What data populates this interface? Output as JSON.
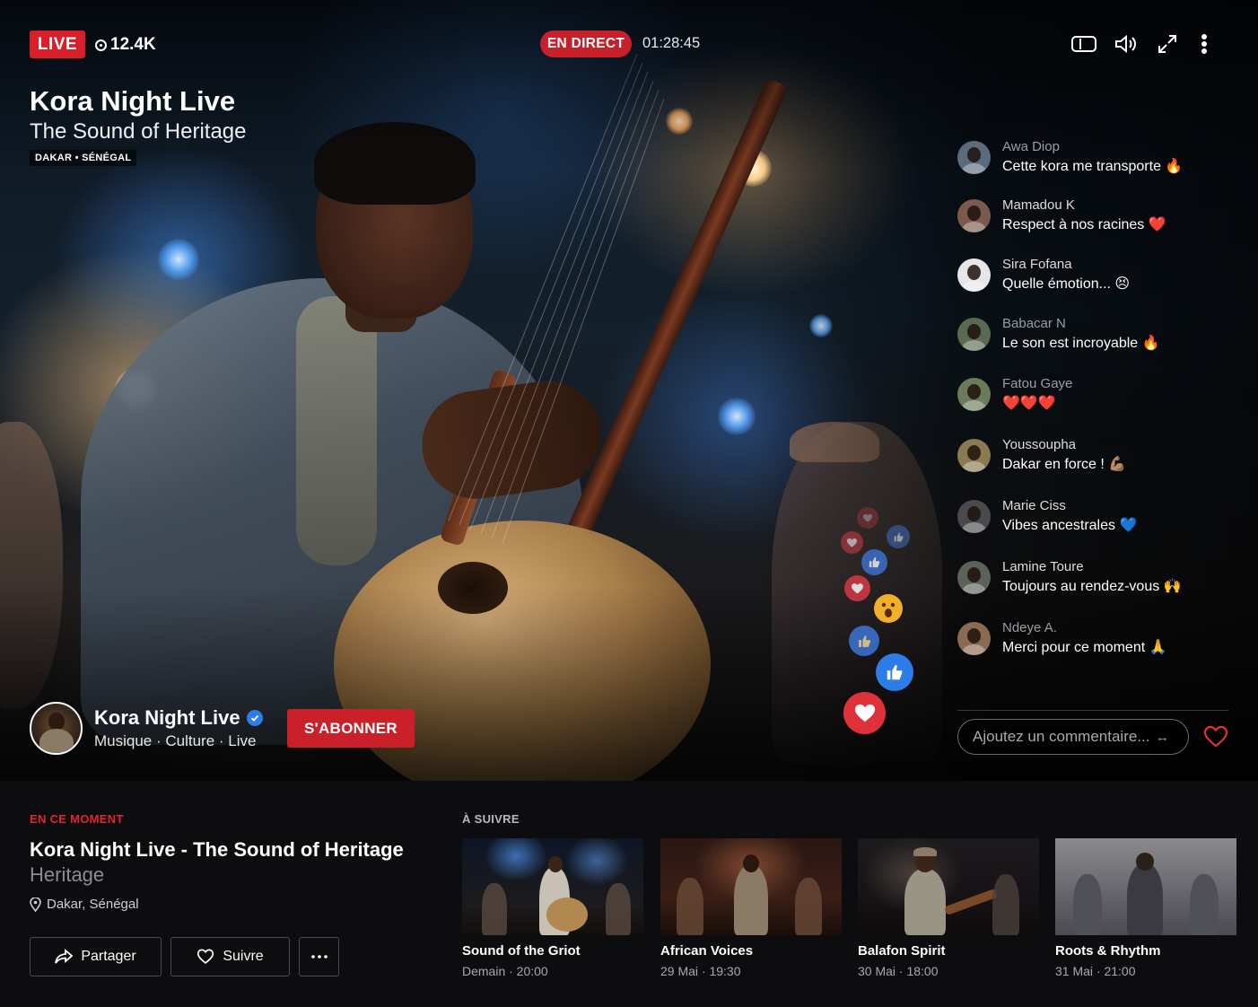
{
  "player": {
    "live_label": "LIVE",
    "viewers": "12.4K",
    "status_badge": "EN DIRECT",
    "elapsed": "01:28:45",
    "title": "Kora Night Live",
    "subtitle": "The Sound of Heritage",
    "location_chip": "DAKAR • SÉNÉGAL",
    "controls": [
      "theater-icon",
      "volume-icon",
      "fullscreen-icon",
      "more-vertical-icon"
    ]
  },
  "channel": {
    "name": "Kora Night Live",
    "tags": "Musique · Culture · Live",
    "subscribe_label": "S'ABONNER",
    "verified": true
  },
  "chat": {
    "messages": [
      {
        "name": "Awa Diop",
        "text": "Cette kora me transporte 🔥",
        "dim": true,
        "avatar_color": "#5b6b7e"
      },
      {
        "name": "Mamadou K",
        "text": "Respect à nos racines ❤️",
        "dim": false,
        "avatar_color": "#7a5a4c"
      },
      {
        "name": "Sira Fofana",
        "text": "Quelle émotion... 😣",
        "dim": false,
        "avatar_color": "#e6e6ea"
      },
      {
        "name": "Babacar N",
        "text": "Le son est incroyable 🔥",
        "dim": true,
        "avatar_color": "#5a6a52"
      },
      {
        "name": "Fatou Gaye",
        "text": "❤️❤️❤️",
        "dim": true,
        "avatar_color": "#6a7a5a"
      },
      {
        "name": "Youssoupha",
        "text": "Dakar en force ! 💪🏽",
        "dim": false,
        "avatar_color": "#8a7a52"
      },
      {
        "name": "Marie Ciss",
        "text": "Vibes ancestrales 💙",
        "dim": false,
        "avatar_color": "#4a4a4e"
      },
      {
        "name": "Lamine Toure",
        "text": "Toujours au rendez-vous 🙌",
        "dim": false,
        "avatar_color": "#5a625a"
      },
      {
        "name": "Ndeye A.",
        "text": "Merci pour ce moment 🙏",
        "dim": true,
        "avatar_color": "#8a6a52"
      }
    ],
    "comment_placeholder": "Ajoutez un commentaire...",
    "reactions": [
      "heart-icon",
      "thumbs-up-icon",
      "heart-icon",
      "thumbs-up-icon",
      "heart-icon",
      "wow-icon",
      "thumbs-up-icon",
      "thumbs-up-icon",
      "heart-icon"
    ]
  },
  "now": {
    "label": "EN CE MOMENT",
    "title": "Kora Night Live - The Sound of Heritage",
    "title_overflow": "Heritage",
    "location": "Dakar, Sénégal",
    "share_label": "Partager",
    "follow_label": "Suivre"
  },
  "up_next": {
    "label": "À SUIVRE",
    "items": [
      {
        "title": "Sound of the Griot",
        "when": "Demain · 20:00"
      },
      {
        "title": "African Voices",
        "when": "29 Mai · 19:30"
      },
      {
        "title": "Balafon Spirit",
        "when": "30 Mai · 18:00"
      },
      {
        "title": "Roots & Rhythm",
        "when": "31 Mai · 21:00"
      }
    ]
  },
  "colors": {
    "live_red": "#d81f2a",
    "subscribe_red": "#c9202a",
    "verified_blue": "#2d7de8",
    "panel_bg": "#0d0d0f"
  }
}
